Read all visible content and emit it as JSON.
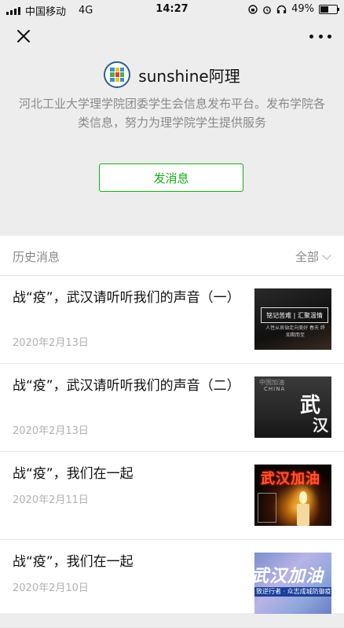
{
  "status_bar": {
    "carrier": "中国移动",
    "network": "4G",
    "time": "14:27",
    "battery_percent": "49%",
    "battery_level": 0.49
  },
  "nav": {
    "close_icon": "close-icon",
    "more_icon": "more-icon"
  },
  "account": {
    "name": "sunshine阿理",
    "description": "河北工业大学理学院团委学生会信息发布平台。发布学院各类信息，努力为理学院学生提供服务",
    "send_button": "发消息",
    "accent_color": "#1aad19"
  },
  "history": {
    "header": "历史消息",
    "filter": "全部",
    "items": [
      {
        "title": "战“疫”，武汉请听听我们的声音（一）",
        "date": "2020年2月13日",
        "thumb": {
          "box": "铭记苦难 | 汇聚温情",
          "sub": "人性从哀恸走向美好 春天 终如期而至"
        }
      },
      {
        "title": "战“疫”，武汉请听听我们的声音（二）",
        "date": "2020年2月13日",
        "thumb": {
          "top": "中国加油",
          "en": "CHINA",
          "big1": "武",
          "big2": "汉"
        }
      },
      {
        "title": "战“疫”，我们在一起",
        "date": "2020年2月11日",
        "thumb": {
          "title": "武汉加油"
        }
      },
      {
        "title": "战“疫”，我们在一起",
        "date": "2020年2月10日",
        "thumb": {
          "title": "武汉加油",
          "bar": "致逆行者 · 众志成城防御疫情"
        }
      }
    ]
  }
}
